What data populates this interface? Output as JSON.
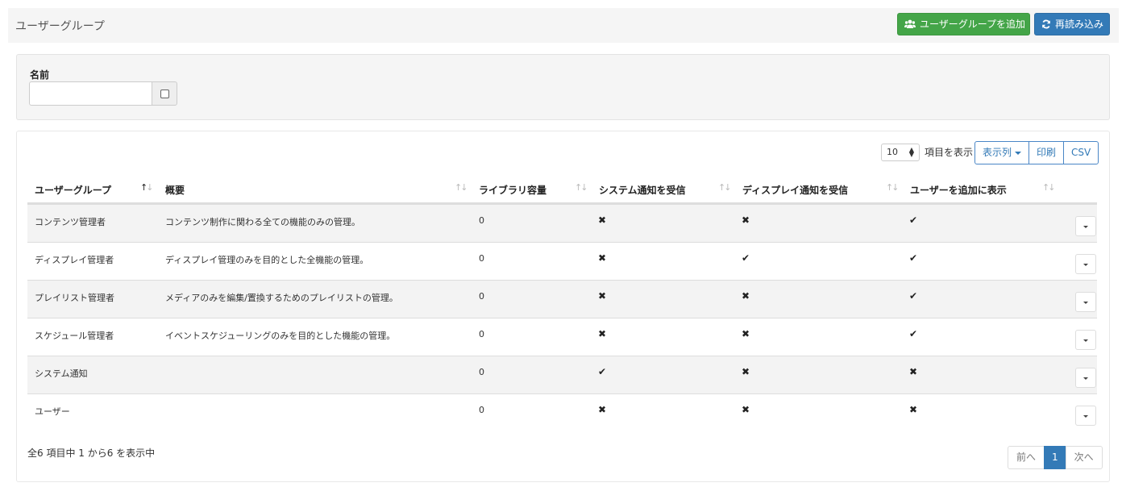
{
  "header": {
    "title": "ユーザーグループ",
    "add_button": "ユーザーグループを追加",
    "reload_button": "再読み込み"
  },
  "filter": {
    "name_label": "名前",
    "name_value": ""
  },
  "table": {
    "page_length": "10",
    "page_length_suffix": "項目を表示",
    "columns_button": "表示列",
    "print_button": "印刷",
    "csv_button": "CSV",
    "headers": [
      "ユーザーグループ",
      "概要",
      "ライブラリ容量",
      "システム通知を受信",
      "ディスプレイ通知を受信",
      "ユーザーを追加に表示"
    ],
    "rows": [
      {
        "name": "コンテンツ管理者",
        "description": "コンテンツ制作に関わる全ての機能のみの管理。",
        "library": "0",
        "system_notify": "✖",
        "display_notify": "✖",
        "show_add_user": "✔"
      },
      {
        "name": "ディスプレイ管理者",
        "description": "ディスプレイ管理のみを目的とした全機能の管理。",
        "library": "0",
        "system_notify": "✖",
        "display_notify": "✔",
        "show_add_user": "✔"
      },
      {
        "name": "プレイリスト管理者",
        "description": "メディアのみを編集/置換するためのプレイリストの管理。",
        "library": "0",
        "system_notify": "✖",
        "display_notify": "✖",
        "show_add_user": "✔"
      },
      {
        "name": "スケジュール管理者",
        "description": "イベントスケジューリングのみを目的とした機能の管理。",
        "library": "0",
        "system_notify": "✖",
        "display_notify": "✖",
        "show_add_user": "✔"
      },
      {
        "name": "システム通知",
        "description": "",
        "library": "0",
        "system_notify": "✔",
        "display_notify": "✖",
        "show_add_user": "✖"
      },
      {
        "name": "ユーザー",
        "description": "",
        "library": "0",
        "system_notify": "✖",
        "display_notify": "✖",
        "show_add_user": "✖"
      }
    ],
    "info": "全6 項目中 1 から6 を表示中",
    "pagination": {
      "prev": "前へ",
      "current": "1",
      "next": "次へ"
    }
  },
  "colors": {
    "add_button": "#44a548",
    "reload_button": "#337ab7",
    "accent": "#337ab7"
  },
  "icons": {
    "add": "users-icon",
    "reload": "refresh-icon"
  }
}
